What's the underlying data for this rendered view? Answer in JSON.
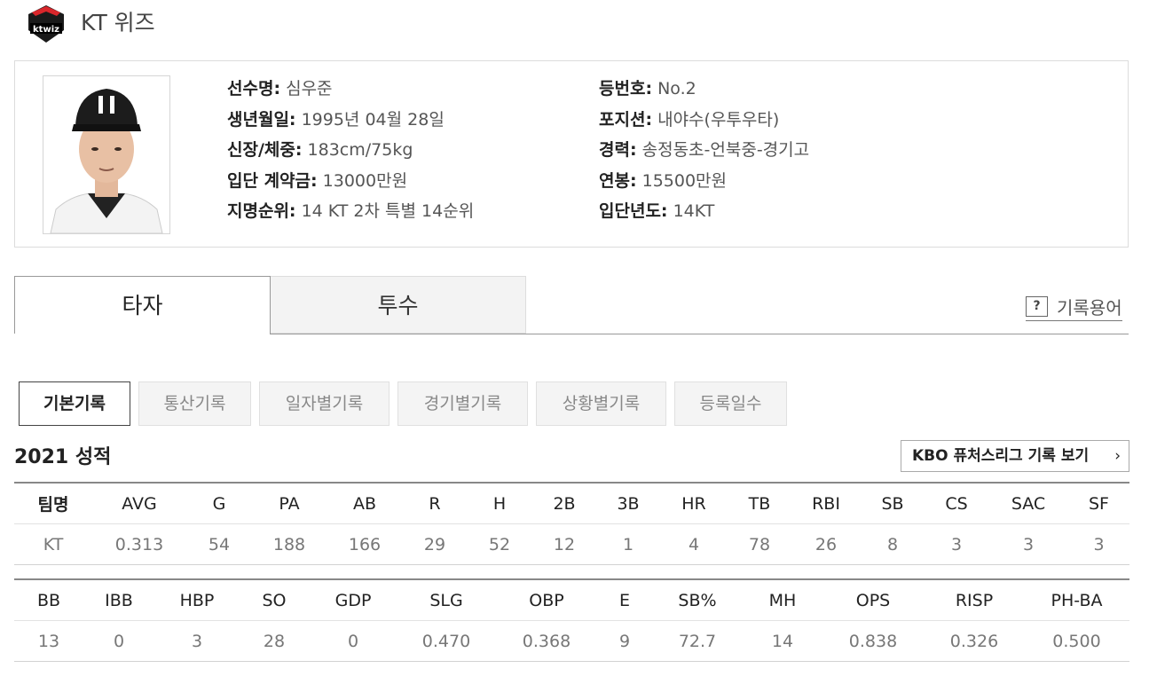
{
  "header": {
    "team_name": "KT 위즈",
    "logo_text": "ktwiz"
  },
  "player": {
    "left": [
      {
        "label": "선수명:",
        "value": "심우준"
      },
      {
        "label": "생년월일:",
        "value": "1995년 04월 28일"
      },
      {
        "label": "신장/체중:",
        "value": "183cm/75kg"
      },
      {
        "label": "입단 계약금:",
        "value": "13000만원"
      },
      {
        "label": "지명순위:",
        "value": "14 KT 2차 특별 14순위"
      }
    ],
    "right": [
      {
        "label": "등번호:",
        "value": "No.2"
      },
      {
        "label": "포지션:",
        "value": "내야수(우투우타)"
      },
      {
        "label": "경력:",
        "value": "송정동초-언북중-경기고"
      },
      {
        "label": "연봉:",
        "value": "15500만원"
      },
      {
        "label": "입단년도:",
        "value": "14KT"
      }
    ]
  },
  "tabs": {
    "batter": "타자",
    "pitcher": "투수"
  },
  "glossary": {
    "icon": "?",
    "label": "기록용어"
  },
  "subtabs": [
    "기본기록",
    "통산기록",
    "일자별기록",
    "경기별기록",
    "상황별기록",
    "등록일수"
  ],
  "season": {
    "title": "2021 성적",
    "futures_button": "KBO 퓨처스리그 기록 보기",
    "arrow": "›"
  },
  "table1": {
    "headers": [
      "팀명",
      "AVG",
      "G",
      "PA",
      "AB",
      "R",
      "H",
      "2B",
      "3B",
      "HR",
      "TB",
      "RBI",
      "SB",
      "CS",
      "SAC",
      "SF"
    ],
    "row": [
      "KT",
      "0.313",
      "54",
      "188",
      "166",
      "29",
      "52",
      "12",
      "1",
      "4",
      "78",
      "26",
      "8",
      "3",
      "3",
      "3"
    ]
  },
  "table2": {
    "headers": [
      "BB",
      "IBB",
      "HBP",
      "SO",
      "GDP",
      "SLG",
      "OBP",
      "E",
      "SB%",
      "MH",
      "OPS",
      "RISP",
      "PH-BA"
    ],
    "row": [
      "13",
      "0",
      "3",
      "28",
      "0",
      "0.470",
      "0.368",
      "9",
      "72.7",
      "14",
      "0.838",
      "0.326",
      "0.500"
    ]
  }
}
